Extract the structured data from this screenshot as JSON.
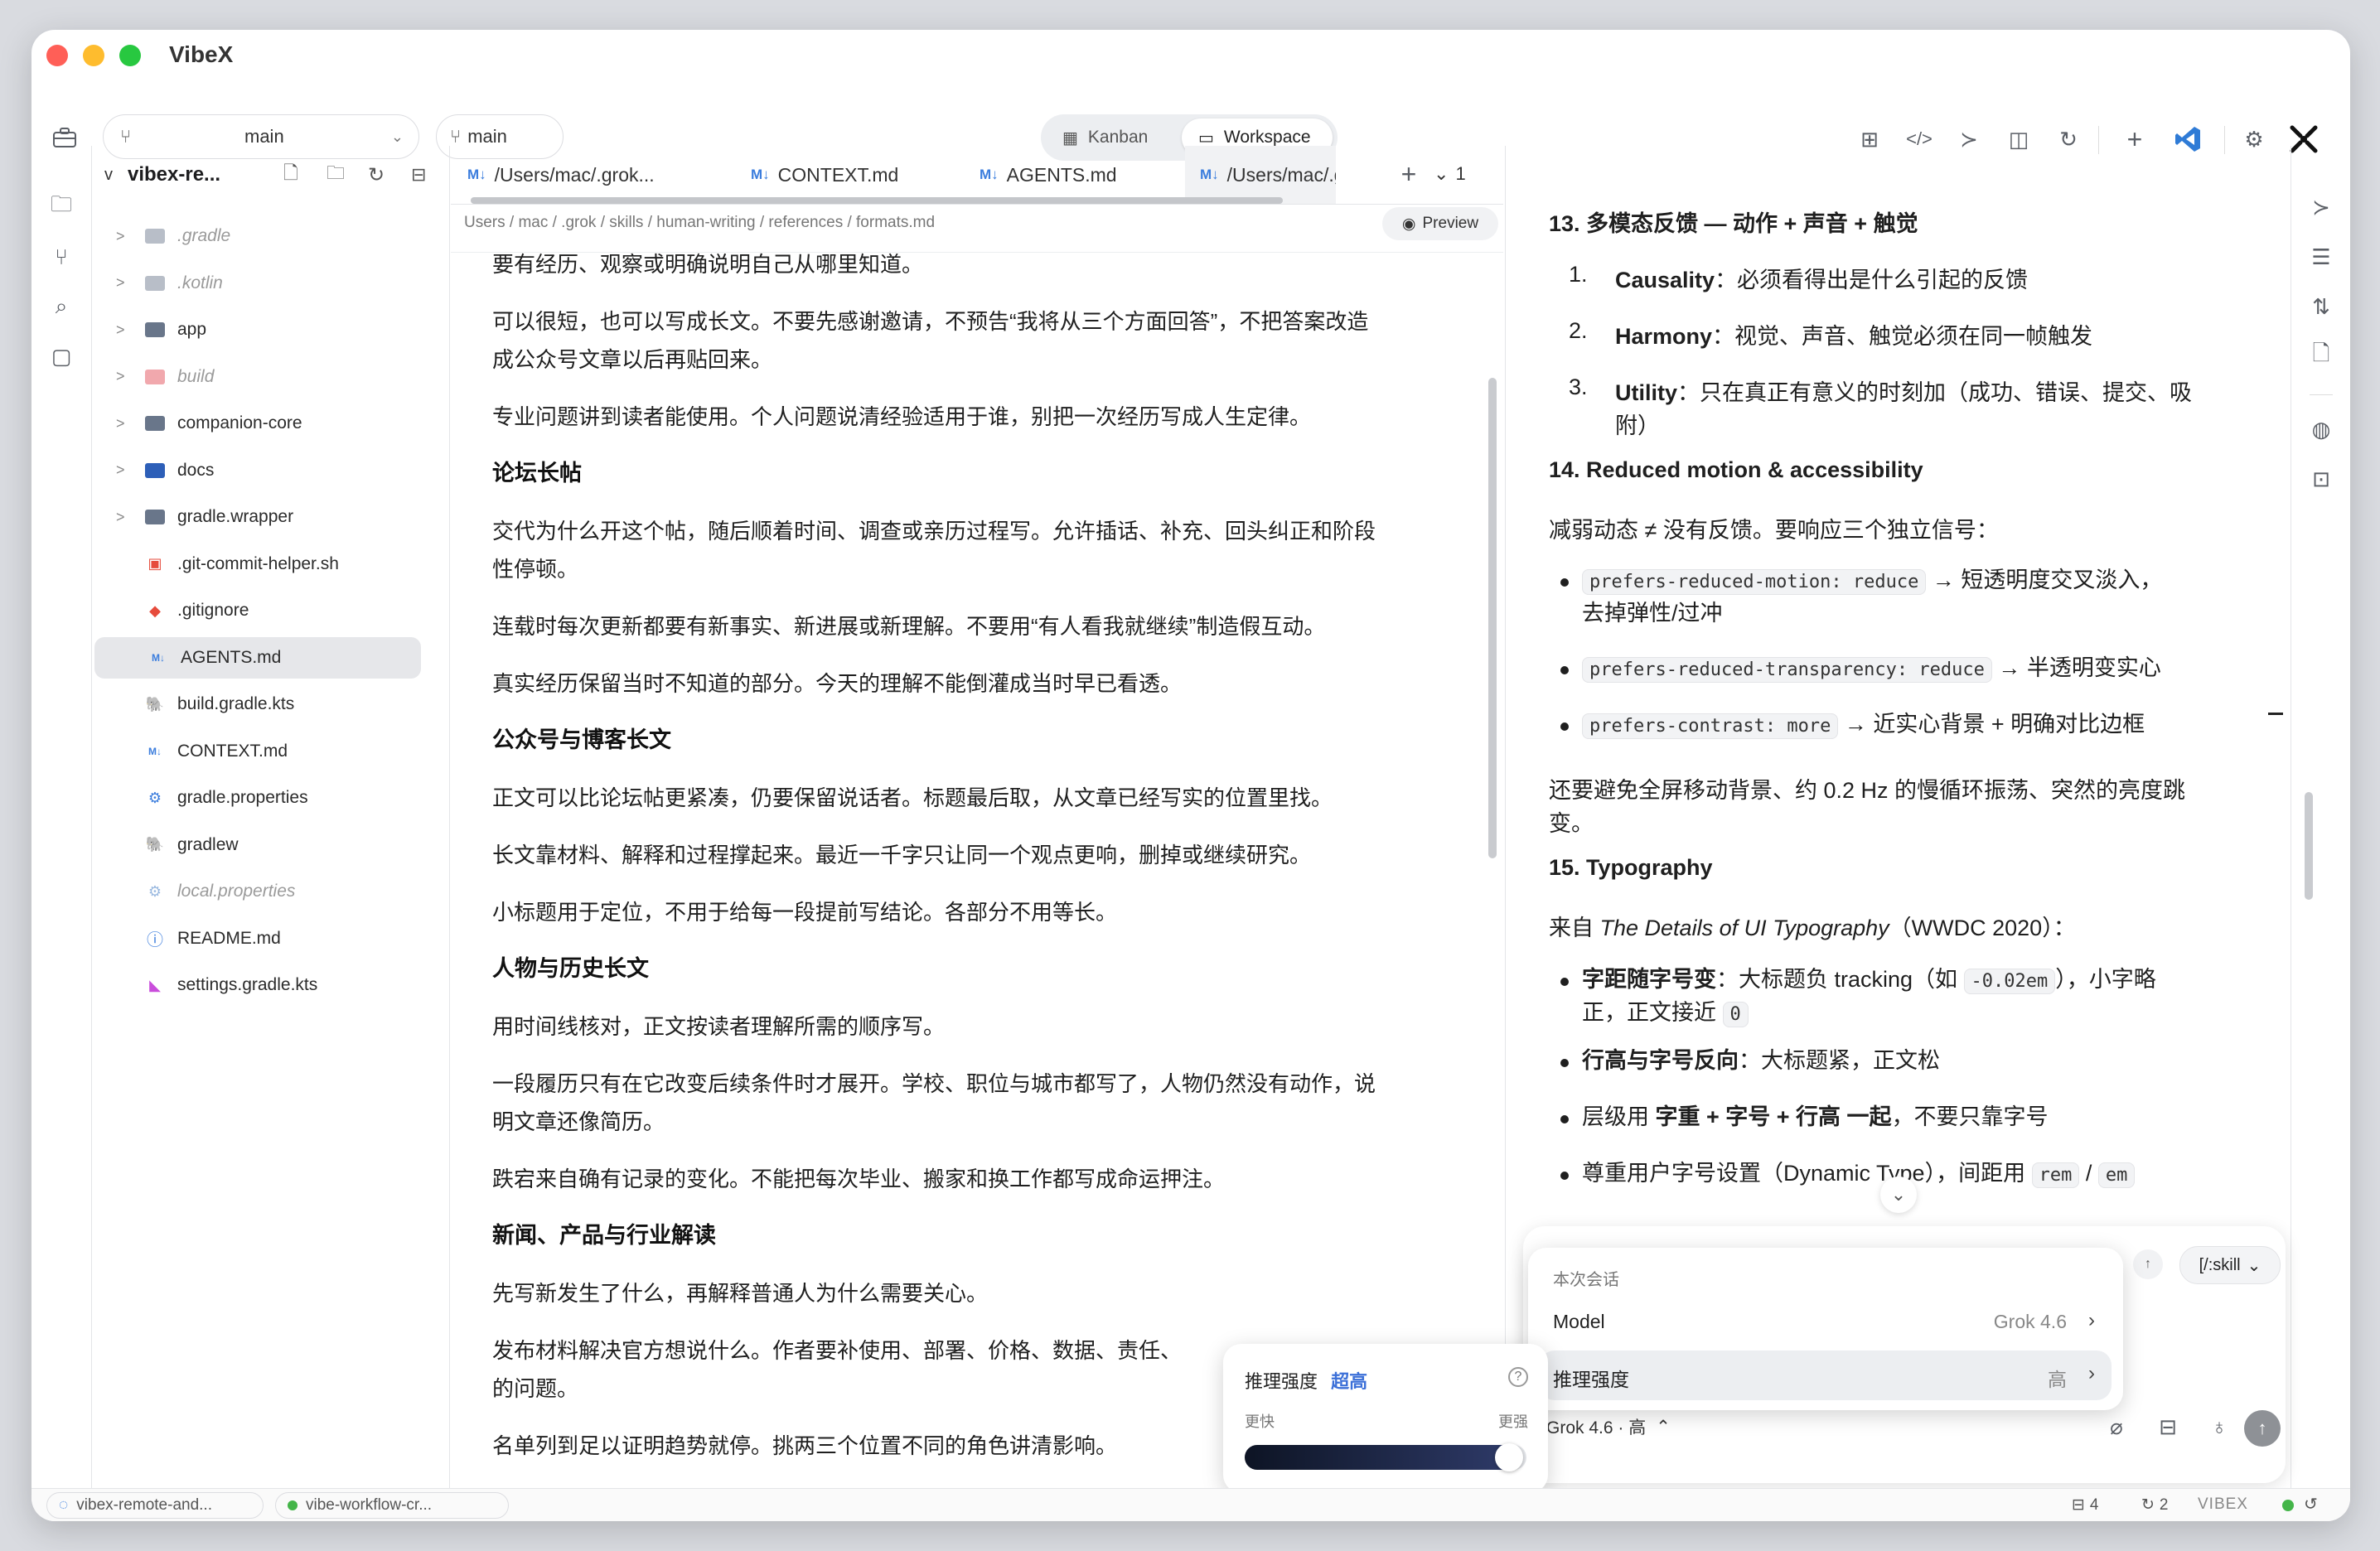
{
  "app": {
    "title": "VibeX"
  },
  "toolbar": {
    "branch_select": "main",
    "branch_chip": "main",
    "views": [
      {
        "label": "Kanban"
      },
      {
        "label": "Workspace"
      }
    ],
    "active_view": "Workspace"
  },
  "tree": {
    "root": "vibex-re...",
    "items": [
      {
        "name": ".gradle",
        "kind": "folder",
        "dim": true
      },
      {
        "name": ".kotlin",
        "kind": "folder",
        "dim": true
      },
      {
        "name": "app",
        "kind": "folder"
      },
      {
        "name": "build",
        "kind": "folder",
        "dim": true
      },
      {
        "name": "companion-core",
        "kind": "folder"
      },
      {
        "name": "docs",
        "kind": "folder"
      },
      {
        "name": "gradle.wrapper",
        "kind": "folder"
      },
      {
        "name": ".git-commit-helper.sh",
        "kind": "file"
      },
      {
        "name": ".gitignore",
        "kind": "file"
      },
      {
        "name": "AGENTS.md",
        "kind": "file",
        "selected": true
      },
      {
        "name": "build.gradle.kts",
        "kind": "file"
      },
      {
        "name": "CONTEXT.md",
        "kind": "file"
      },
      {
        "name": "gradle.properties",
        "kind": "file"
      },
      {
        "name": "gradlew",
        "kind": "file"
      },
      {
        "name": "local.properties",
        "kind": "file",
        "dim": true
      },
      {
        "name": "README.md",
        "kind": "file"
      },
      {
        "name": "settings.gradle.kts",
        "kind": "file"
      }
    ]
  },
  "editor": {
    "tabs": [
      "/Users/mac/.grok...",
      "CONTEXT.md",
      "AGENTS.md",
      "/Users/mac/.grc"
    ],
    "tab_counter": "1",
    "breadcrumbs": "Users / mac / .grok / skills / human-writing / references / formats.md",
    "preview_label": "Preview",
    "blocks": [
      {
        "type": "p",
        "text": "要有经历、观察或明确说明自己从哪里知道。"
      },
      {
        "type": "p",
        "text": "可以很短，也可以写成长文。不要先感谢邀请，不预告“我将从三个方面回答”，不把答案改造"
      },
      {
        "type": "p",
        "text": "成公众号文章以后再贴回来。"
      },
      {
        "type": "p",
        "text": "专业问题讲到读者能使用。个人问题说清经验适用于谁，别把一次经历写成人生定律。"
      },
      {
        "type": "h",
        "text": "论坛长帖"
      },
      {
        "type": "p",
        "text": "交代为什么开这个帖，随后顺着时间、调查或亲历过程写。允许插话、补充、回头纠正和阶段"
      },
      {
        "type": "p",
        "text": "性停顿。"
      },
      {
        "type": "p",
        "text": "连载时每次更新都要有新事实、新进展或新理解。不要用“有人看我就继续”制造假互动。"
      },
      {
        "type": "p",
        "text": "真实经历保留当时不知道的部分。今天的理解不能倒灌成当时早已看透。"
      },
      {
        "type": "h",
        "text": "公众号与博客长文"
      },
      {
        "type": "p",
        "text": "正文可以比论坛帖更紧凑，仍要保留说话者。标题最后取，从文章已经写实的位置里找。"
      },
      {
        "type": "p",
        "text": "长文靠材料、解释和过程撑起来。最近一千字只让同一个观点更响，删掉或继续研究。"
      },
      {
        "type": "p",
        "text": "小标题用于定位，不用于给每一段提前写结论。各部分不用等长。"
      },
      {
        "type": "h",
        "text": "人物与历史长文"
      },
      {
        "type": "p",
        "text": "用时间线核对，正文按读者理解所需的顺序写。"
      },
      {
        "type": "p",
        "text": "一段履历只有在它改变后续条件时才展开。学校、职位与城市都写了，人物仍然没有动作，说"
      },
      {
        "type": "p",
        "text": "明文章还像简历。"
      },
      {
        "type": "p",
        "text": "跌宕来自确有记录的变化。不能把每次毕业、搬家和换工作都写成命运押注。"
      },
      {
        "type": "h",
        "text": "新闻、产品与行业解读"
      },
      {
        "type": "p",
        "text": "先写新发生了什么，再解释普通人为什么需要关心。"
      },
      {
        "type": "p",
        "text": "发布材料解决官方想说什么。作者要补使用、部署、价格、数据、责任、"
      },
      {
        "type": "p",
        "text": "的问题。"
      },
      {
        "type": "p",
        "text": "名单列到足以证明趋势就停。挑两三个位置不同的角色讲清影响。"
      }
    ]
  },
  "preview": {
    "h13": "13. 多模态反馈 — 动作 + 声音 + 触觉",
    "list13": [
      {
        "num": "1.",
        "term": "Causality",
        "text": "：必须看得出是什么引起的反馈"
      },
      {
        "num": "2.",
        "term": "Harmony",
        "text": "：视觉、声音、触觉必须在同一帧触发"
      },
      {
        "num": "3.",
        "term": "Utility",
        "text": "：只在真正有意义的时刻加（成功、错误、提交、吸",
        "cont": "附）"
      }
    ],
    "h14": "14. Reduced motion & accessibility",
    "p14": "减弱动态 ≠ 没有反馈。要响应三个独立信号：",
    "list14": [
      {
        "code": "prefers-reduced-motion: reduce",
        "text": " → 短透明度交叉淡入，",
        "cont": "去掉弹性/过冲"
      },
      {
        "code": "prefers-reduced-transparency: reduce",
        "text": " → 半透明变实心"
      },
      {
        "code": "prefers-contrast: more",
        "text": " → 近实心背景 + 明确对比边框"
      }
    ],
    "p14b": "还要避免全屏移动背景、约 0.2 Hz 的慢循环振荡、突然的亮度跳",
    "p14b_cont": "变。",
    "h15": "15. Typography",
    "p15_prefix": "来自 ",
    "p15_italic": "The Details of UI Typography",
    "p15_suffix": "（WWDC 2020）：",
    "list15": [
      {
        "bold": "字距随字号变",
        "text": "：大标题负 tracking（如 ",
        "code": "-0.02em",
        "tail": "），小字略",
        "cont": "正，正文接近 ",
        "code2": "0"
      },
      {
        "bold": "行高与字号反向",
        "text": "：大标题紧，正文松"
      },
      {
        "text_plain": "层级用 ",
        "bold": "字重 + 字号 + 行高 一起",
        "text": "，不要只靠字号"
      },
      {
        "text_plain": "尊重用户字号设置（Dynamic Type），间距用 ",
        "code": "rem",
        "mid": " / ",
        "code2": "em"
      }
    ]
  },
  "session_menu": {
    "header": "本次会话",
    "rows": [
      {
        "label": "Model",
        "value": "Grok 4.6"
      },
      {
        "label": "推理强度",
        "value": "高"
      }
    ]
  },
  "composer": {
    "skill_button": "[/:skill",
    "model_chip": "Grok 4.6 · 高"
  },
  "effort_popup": {
    "title": "推理强度",
    "level": "超高",
    "left_label": "更快",
    "right_label": "更强",
    "slider_fraction": 0.97
  },
  "status": {
    "left_pill": "vibex-remote-and...",
    "right_pill": "vibe-workflow-cr...",
    "inbox_count": "4",
    "sync_count": "2",
    "brand": "VIBEX"
  },
  "colors": {
    "accent": "#3b7ddd",
    "vscode": "#2f7bd6",
    "red": "#ff5f57",
    "yellow": "#febc2e",
    "green": "#28c840",
    "status_green": "#44b549"
  }
}
